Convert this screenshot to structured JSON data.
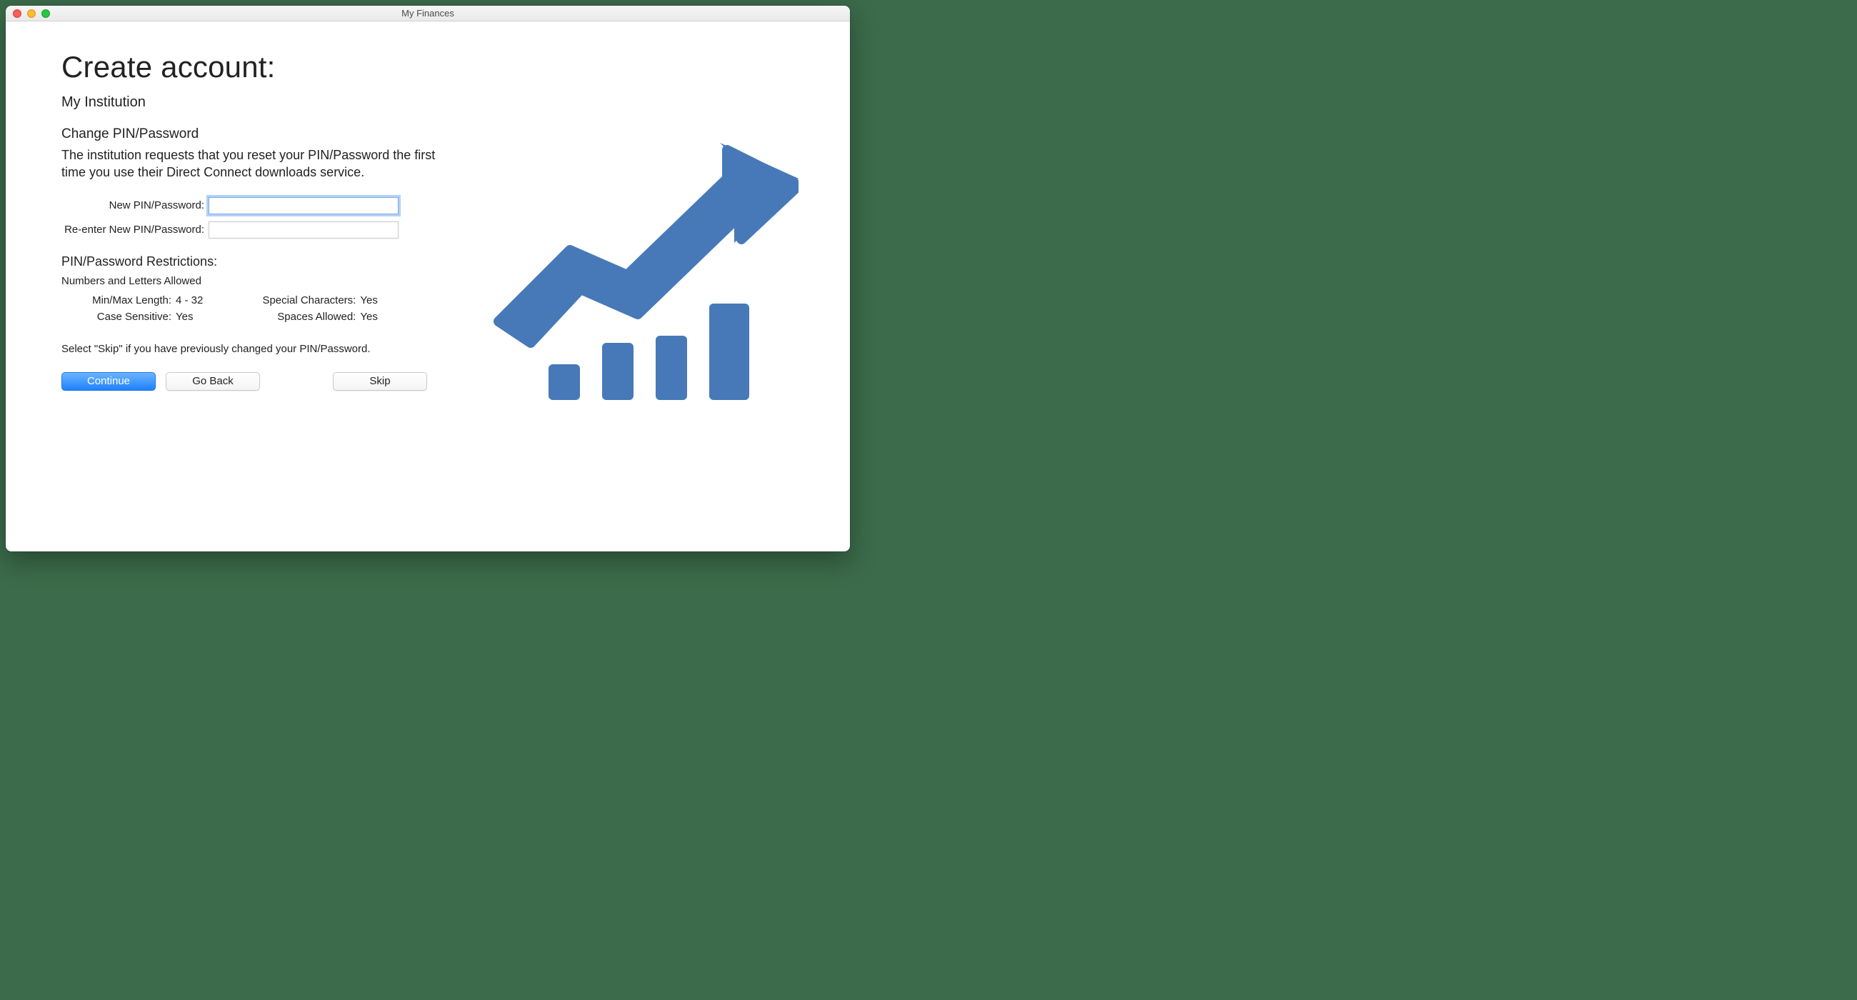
{
  "window": {
    "title": "My Finances"
  },
  "page": {
    "heading": "Create account:",
    "institution": "My Institution",
    "section_heading": "Change PIN/Password",
    "description": "The institution requests that you reset your PIN/Password the first time you use their Direct Connect downloads service.",
    "skip_note": "Select \"Skip\" if you have previously changed your PIN/Password."
  },
  "form": {
    "new_pin_label": "New PIN/Password:",
    "new_pin_value": "",
    "reenter_label": "Re-enter New PIN/Password:",
    "reenter_value": ""
  },
  "restrictions": {
    "heading": "PIN/Password Restrictions:",
    "allowed": "Numbers and Letters Allowed",
    "minmax_label": "Min/Max Length:",
    "minmax_value": "4 - 32",
    "case_label": "Case Sensitive:",
    "case_value": "Yes",
    "special_label": "Special Characters:",
    "special_value": "Yes",
    "spaces_label": "Spaces Allowed:",
    "spaces_value": "Yes"
  },
  "buttons": {
    "continue": "Continue",
    "go_back": "Go Back",
    "skip": "Skip"
  },
  "illustration": {
    "name": "growth-chart-icon",
    "color": "#4779b8"
  }
}
